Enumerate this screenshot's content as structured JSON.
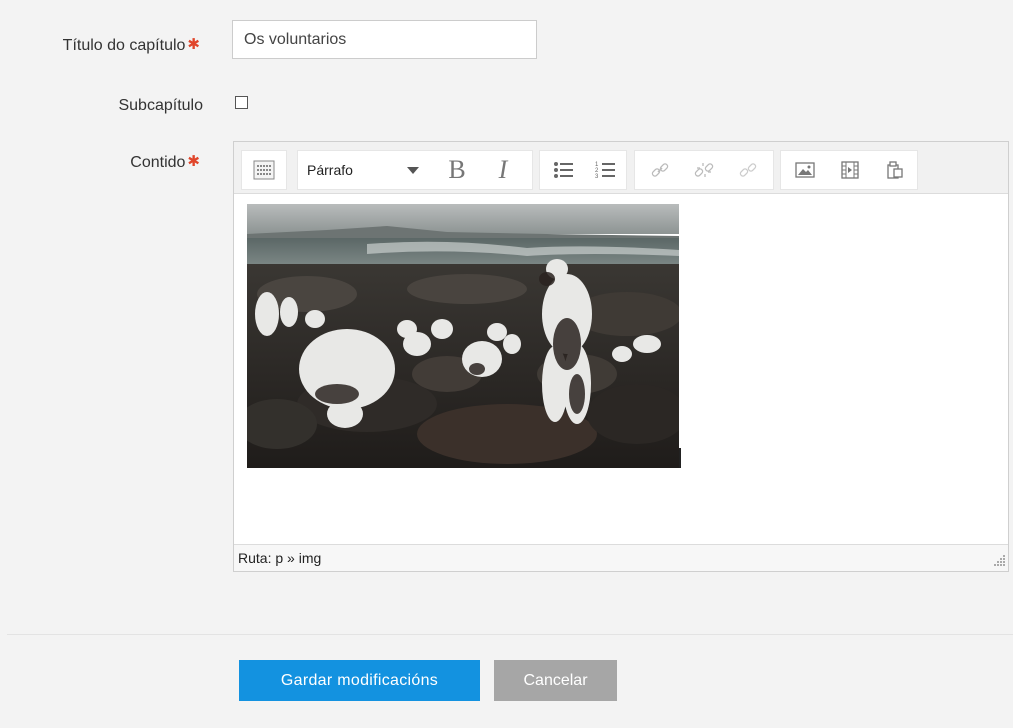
{
  "form": {
    "title_label": "Título do capítulo",
    "title_value": "Os voluntarios",
    "required_mark": "✱",
    "subchapter_label": "Subcapítulo",
    "subchapter_checked": false,
    "content_label": "Contido"
  },
  "editor": {
    "format_value": "Párrafo",
    "bold_label": "B",
    "italic_label": "I",
    "toolbar_icons": [
      "toolbar-toggle-icon",
      "bullet-list-icon",
      "numbered-list-icon",
      "link-icon",
      "unlink-icon",
      "anchor-link-icon",
      "insert-image-icon",
      "insert-media-icon",
      "paste-icon"
    ],
    "status_path": "Ruta: p » img"
  },
  "buttons": {
    "save_label": "Gardar modificacións",
    "cancel_label": "Cancelar"
  },
  "colors": {
    "primary": "#1392e0",
    "secondary": "#a6a6a6",
    "required": "#e0452a"
  }
}
